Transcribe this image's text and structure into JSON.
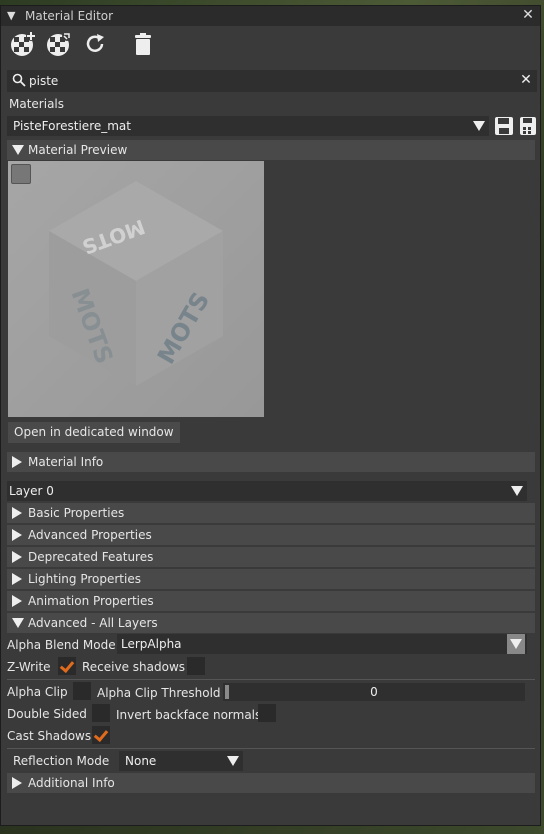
{
  "window": {
    "title": "Material Editor"
  },
  "toolbar": {
    "buttons": [
      "new-material-icon",
      "clone-material-icon",
      "refresh-icon",
      "trash-icon"
    ]
  },
  "search": {
    "value": "piste"
  },
  "materials": {
    "label": "Materials",
    "selected": "PisteForestiere_mat"
  },
  "preview": {
    "header": "Material Preview",
    "open_button": "Open in dedicated window",
    "texture_text": "MOTS"
  },
  "material_info": {
    "header": "Material Info"
  },
  "layer": {
    "selected": "Layer 0"
  },
  "sections": [
    {
      "label": "Basic Properties"
    },
    {
      "label": "Advanced Properties"
    },
    {
      "label": "Deprecated Features"
    },
    {
      "label": "Lighting Properties"
    },
    {
      "label": "Animation Properties"
    }
  ],
  "advanced_all": {
    "header": "Advanced - All Layers",
    "alpha_blend_label": "Alpha Blend Mode",
    "alpha_blend_value": "LerpAlpha",
    "zwrite_label": "Z-Write",
    "zwrite": true,
    "receive_shadows_label": "Receive shadows",
    "receive_shadows": false,
    "alpha_clip_label": "Alpha Clip",
    "alpha_clip": false,
    "alpha_clip_threshold_label": "Alpha Clip Threshold",
    "alpha_clip_threshold": "0",
    "double_sided_label": "Double Sided",
    "double_sided": false,
    "invert_backface_label": "Invert backface normals",
    "invert_backface": false,
    "cast_shadows_label": "Cast Shadows",
    "cast_shadows": true
  },
  "reflection": {
    "label": "Reflection Mode",
    "value": "None"
  },
  "additional_info": {
    "header": "Additional Info"
  },
  "colors": {
    "accent": "#e06b1c",
    "panel": "#3a3a3a",
    "header": "#494949"
  }
}
